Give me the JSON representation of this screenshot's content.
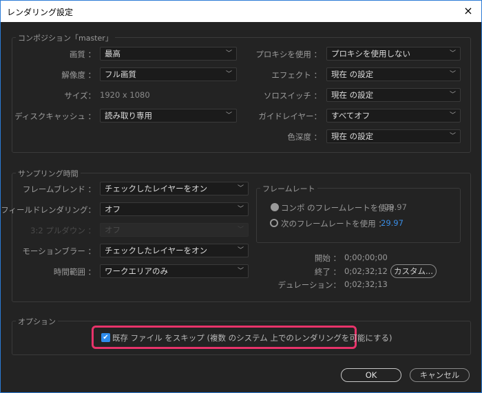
{
  "window": {
    "title": "レンダリング設定",
    "close_icon": "×"
  },
  "composition": {
    "legend": "コンポジション「master」",
    "left": [
      {
        "label": "画質 ：",
        "value": "最高"
      },
      {
        "label": "解像度 ：",
        "value": "フル画質"
      },
      {
        "label": "サイズ：",
        "value": "1920 x 1080"
      },
      {
        "label": "ディスクキャッシュ ：",
        "value": "読み取り専用"
      }
    ],
    "right": [
      {
        "label": "プロキシを使用 ：",
        "value": "プロキシを使用しない"
      },
      {
        "label": "エフェクト ：",
        "value": "現在 の設定"
      },
      {
        "label": "ソロスイッチ ：",
        "value": "現在 の設定"
      },
      {
        "label": "ガイドレイヤー：",
        "value": "すべてオフ"
      },
      {
        "label": "色深度 ：",
        "value": "現在 の設定"
      }
    ]
  },
  "sampling": {
    "legend": "サンプリング時間",
    "rows": [
      {
        "label": "フレームブレンド ：",
        "value": "チェックしたレイヤーをオン",
        "disabled": false
      },
      {
        "label": "フィールドレンダリング：",
        "value": "オフ",
        "disabled": false
      },
      {
        "label": "3:2 プルダウン ：",
        "value": "オフ",
        "disabled": true
      },
      {
        "label": "モーションブラー ：",
        "value": "チェックしたレイヤーをオン",
        "disabled": false
      },
      {
        "label": "時間範囲 ：",
        "value": "ワークエリアのみ",
        "disabled": false
      }
    ],
    "framerate": {
      "legend": "フレームレート",
      "option1": {
        "label": "コンポ のフレームレートを使用",
        "value": "29.97",
        "selected": true
      },
      "option2": {
        "label": "次のフレームレートを使用 ：",
        "value": "29.97",
        "selected": false
      }
    },
    "start": {
      "label": "開始 ：",
      "value": "0;00;00;00"
    },
    "end": {
      "label": "終了 ：",
      "value": "0;02;32;12"
    },
    "duration": {
      "label": "デュレーション：",
      "value": "0;02;32;13"
    },
    "custom_button": "カスタム..."
  },
  "options": {
    "legend": "オプション",
    "skip_existing": {
      "label": "既存 ファイル をスキップ (複数 のシステム 上でのレンダリングを可能にする)",
      "checked": true
    }
  },
  "buttons": {
    "ok": "OK",
    "cancel": "キャンセル"
  },
  "colors": {
    "accent": "#2d8ceb",
    "highlight": "#e8336a",
    "value_blue": "#3a8ee6"
  }
}
